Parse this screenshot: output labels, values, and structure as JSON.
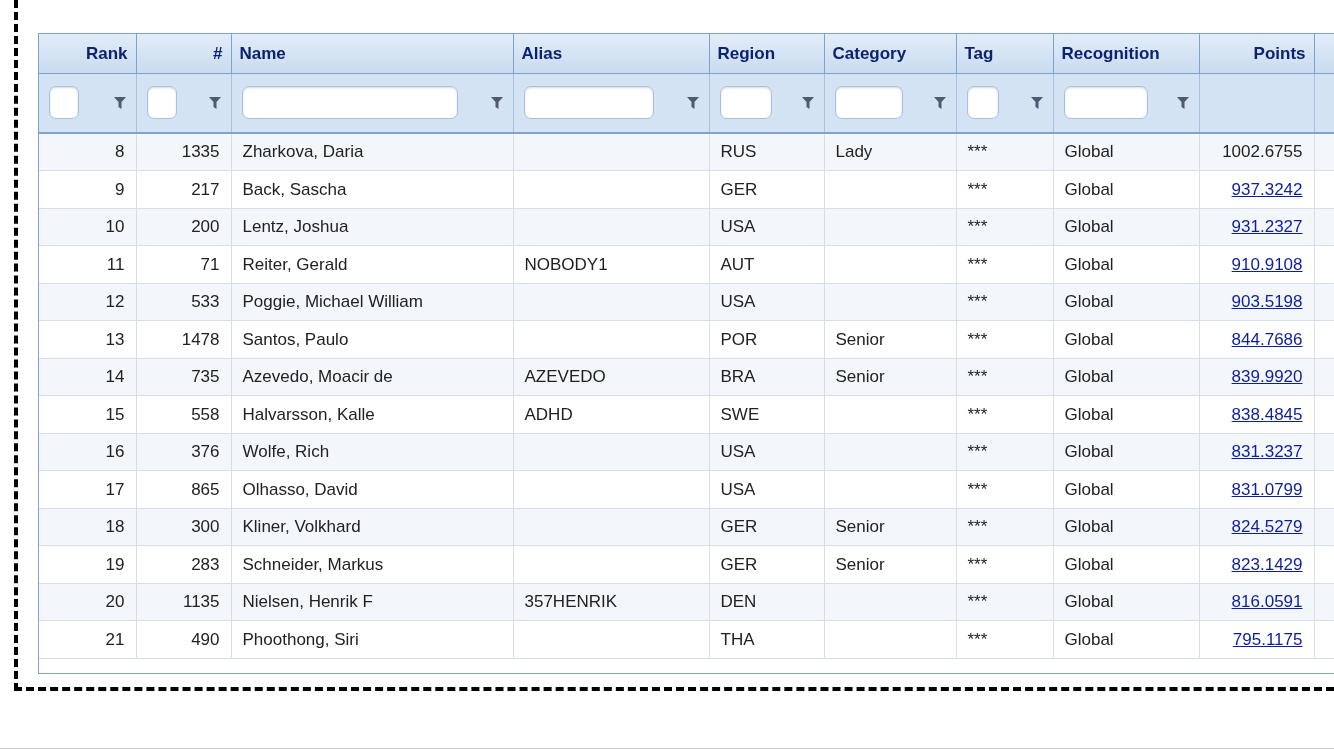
{
  "table": {
    "columns": [
      {
        "label": "Rank",
        "kind": "numeric",
        "filterable": true
      },
      {
        "label": "#",
        "kind": "numeric",
        "filterable": true
      },
      {
        "label": "Name",
        "kind": "text",
        "filterable": true
      },
      {
        "label": "Alias",
        "kind": "text",
        "filterable": true
      },
      {
        "label": "Region",
        "kind": "text",
        "filterable": true
      },
      {
        "label": "Category",
        "kind": "text",
        "filterable": true
      },
      {
        "label": "Tag",
        "kind": "text",
        "filterable": true
      },
      {
        "label": "Recognition",
        "kind": "text",
        "filterable": true
      },
      {
        "label": "Points",
        "kind": "numeric",
        "filterable": false
      }
    ],
    "rows": [
      {
        "rank": "8",
        "number": "1335",
        "name": "Zharkova, Daria",
        "alias": "",
        "region": "RUS",
        "category": "Lady",
        "tag": "***",
        "recognition": "Global",
        "points": "1002.6755",
        "points_link": false
      },
      {
        "rank": "9",
        "number": "217",
        "name": "Back, Sascha",
        "alias": "",
        "region": "GER",
        "category": "",
        "tag": "***",
        "recognition": "Global",
        "points": "937.3242",
        "points_link": true
      },
      {
        "rank": "10",
        "number": "200",
        "name": "Lentz, Joshua",
        "alias": "",
        "region": "USA",
        "category": "",
        "tag": "***",
        "recognition": "Global",
        "points": "931.2327",
        "points_link": true
      },
      {
        "rank": "11",
        "number": "71",
        "name": "Reiter, Gerald",
        "alias": "NOBODY1",
        "region": "AUT",
        "category": "",
        "tag": "***",
        "recognition": "Global",
        "points": "910.9108",
        "points_link": true
      },
      {
        "rank": "12",
        "number": "533",
        "name": "Poggie, Michael William",
        "alias": "",
        "region": "USA",
        "category": "",
        "tag": "***",
        "recognition": "Global",
        "points": "903.5198",
        "points_link": true
      },
      {
        "rank": "13",
        "number": "1478",
        "name": "Santos, Paulo",
        "alias": "",
        "region": "POR",
        "category": "Senior",
        "tag": "***",
        "recognition": "Global",
        "points": "844.7686",
        "points_link": true
      },
      {
        "rank": "14",
        "number": "735",
        "name": "Azevedo, Moacir de",
        "alias": "AZEVEDO",
        "region": "BRA",
        "category": "Senior",
        "tag": "***",
        "recognition": "Global",
        "points": "839.9920",
        "points_link": true
      },
      {
        "rank": "15",
        "number": "558",
        "name": "Halvarsson, Kalle",
        "alias": "ADHD",
        "region": "SWE",
        "category": "",
        "tag": "***",
        "recognition": "Global",
        "points": "838.4845",
        "points_link": true
      },
      {
        "rank": "16",
        "number": "376",
        "name": "Wolfe, Rich",
        "alias": "",
        "region": "USA",
        "category": "",
        "tag": "***",
        "recognition": "Global",
        "points": "831.3237",
        "points_link": true
      },
      {
        "rank": "17",
        "number": "865",
        "name": "Olhasso, David",
        "alias": "",
        "region": "USA",
        "category": "",
        "tag": "***",
        "recognition": "Global",
        "points": "831.0799",
        "points_link": true
      },
      {
        "rank": "18",
        "number": "300",
        "name": "Kliner, Volkhard",
        "alias": "",
        "region": "GER",
        "category": "Senior",
        "tag": "***",
        "recognition": "Global",
        "points": "824.5279",
        "points_link": true
      },
      {
        "rank": "19",
        "number": "283",
        "name": "Schneider, Markus",
        "alias": "",
        "region": "GER",
        "category": "Senior",
        "tag": "***",
        "recognition": "Global",
        "points": "823.1429",
        "points_link": true
      },
      {
        "rank": "20",
        "number": "1135",
        "name": "Nielsen, Henrik F",
        "alias": "357HENRIK",
        "region": "DEN",
        "category": "",
        "tag": "***",
        "recognition": "Global",
        "points": "816.0591",
        "points_link": true
      },
      {
        "rank": "21",
        "number": "490",
        "name": "Phoothong, Siri",
        "alias": "",
        "region": "THA",
        "category": "",
        "tag": "***",
        "recognition": "Global",
        "points": "795.1175",
        "points_link": true
      }
    ]
  }
}
